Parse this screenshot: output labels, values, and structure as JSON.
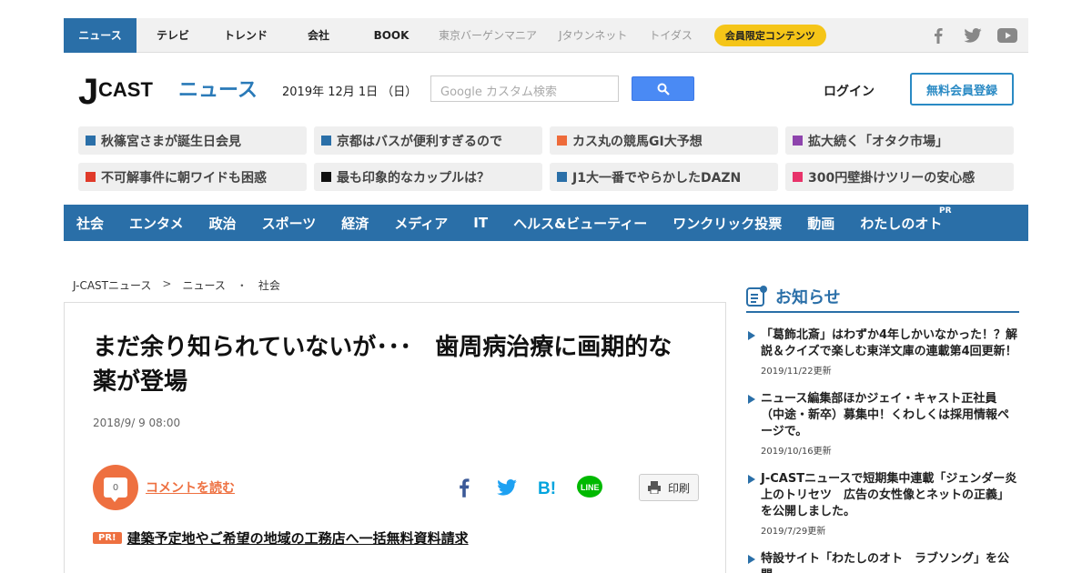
{
  "topnav": {
    "items": [
      "ニュース",
      "テレビ",
      "トレンド",
      "会社",
      "BOOK"
    ],
    "sub_items": [
      "東京バーゲンマニア",
      "Jタウンネット",
      "トイダス"
    ],
    "member_label": "会員限定コンテンツ",
    "social_icons": [
      "facebook-icon",
      "twitter-icon",
      "youtube-icon"
    ]
  },
  "header": {
    "logo_j": "J",
    "logo_cast": "CAST",
    "logo_news": "ニュース",
    "date": "2019年 12月 1日 （日）",
    "search_placeholder": "Google カスタム検索",
    "login": "ログイン",
    "register": "無料会員登録"
  },
  "tiles": [
    {
      "label": "秋篠宮さまが誕生日会見",
      "color": "#2a6fa8"
    },
    {
      "label": "京都はバスが便利すぎるので",
      "color": "#2a6fa8"
    },
    {
      "label": "カス丸の競馬GI大予想",
      "color": "#ee6b3a"
    },
    {
      "label": "拡大続く「オタク市場」",
      "color": "#8e44ad"
    },
    {
      "label": "不可解事件に朝ワイドも困惑",
      "color": "#e03a2a"
    },
    {
      "label": "最も印象的なカップルは？",
      "color": "#111111"
    },
    {
      "label": "J1大一番でやらかしたDAZN",
      "color": "#2a6fa8"
    },
    {
      "label": "300円壁掛けツリーの安心感",
      "color": "#e8336a"
    }
  ],
  "catnav": {
    "items": [
      "社会",
      "エンタメ",
      "政治",
      "スポーツ",
      "経済",
      "メディア",
      "IT",
      "ヘルス&ビューティー",
      "ワンクリック投票",
      "動画",
      "わたしのオト"
    ],
    "pr": "PR"
  },
  "breadcrumb": [
    "J-CASTニュース",
    ">",
    "ニュース",
    "・",
    "社会"
  ],
  "article": {
    "title": "まだ余り知られていないが･･･　歯周病治療に画期的な薬が登場",
    "date": "2018/9/ 9 08:00",
    "comment_count": "0",
    "comment_link": "コメントを読む",
    "print": "印刷",
    "pr_badge": "PR!",
    "pr_link": "建築予定地やご希望の地域の工務店へ一括無料資料請求"
  },
  "sidebar": {
    "title": "お知らせ",
    "items": [
      {
        "text": "「葛飾北斎」はわずか4年しかいなかった！？解説＆クイズで楽しむ東洋文庫の連載第4回更新！",
        "date": "2019/11/22更新"
      },
      {
        "text": "ニュース編集部ほかジェイ・キャスト正社員（中途・新卒）募集中！くわしくは採用情報ページで。",
        "date": "2019/10/16更新"
      },
      {
        "text": "J-CASTニュースで短期集中連載「ジェンダー炎上のトリセツ　広告の女性像とネットの正義」を公開しました。",
        "date": "2019/7/29更新"
      },
      {
        "text": "特設サイト「わたしのオト　ラブソング」を公開",
        "date": ""
      }
    ]
  }
}
